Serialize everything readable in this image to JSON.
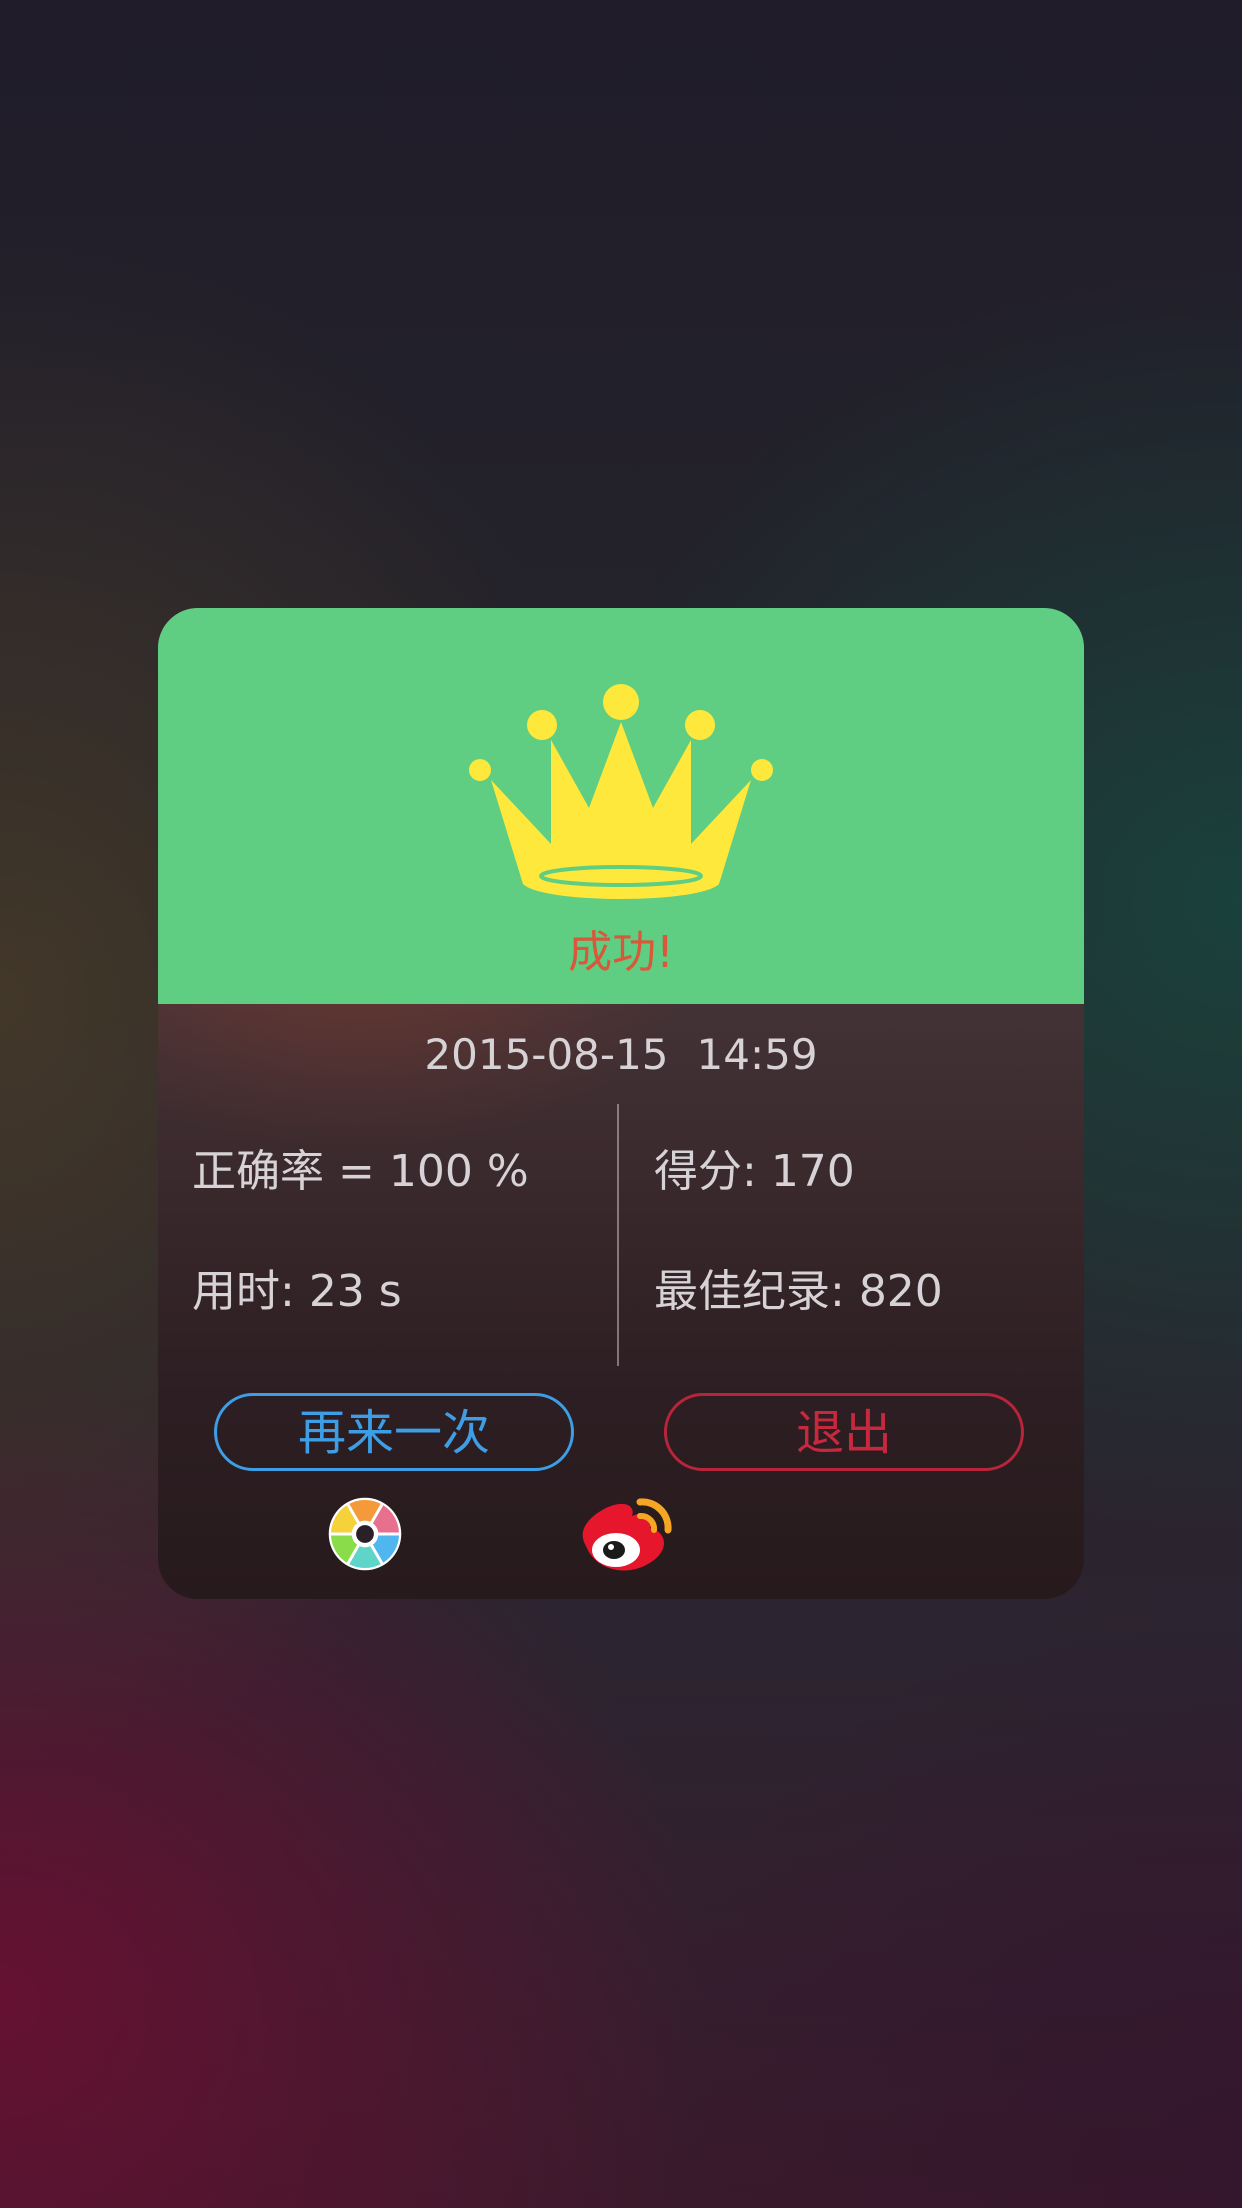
{
  "result": {
    "title": "成功!",
    "icon": "crown-icon",
    "colors": {
      "header_bg": "#5fce82",
      "crown": "#ffe83c",
      "title_text": "#d9573a"
    }
  },
  "session": {
    "date": "2015-08-15",
    "time": "14:59"
  },
  "stats": {
    "accuracy_label": "正确率 = ",
    "accuracy_value": "100 %",
    "score_label": "得分: ",
    "score_value": "170",
    "time_label": "用时: ",
    "time_value": "23 s",
    "best_label": "最佳纪录: ",
    "best_value": "820"
  },
  "actions": {
    "retry_label": "再来一次",
    "exit_label": "退出",
    "retry_color": "#3d9ee6",
    "exit_color": "#c8283e"
  },
  "share": {
    "items": [
      {
        "icon": "moments-aperture-icon"
      },
      {
        "icon": "weibo-icon"
      }
    ]
  }
}
